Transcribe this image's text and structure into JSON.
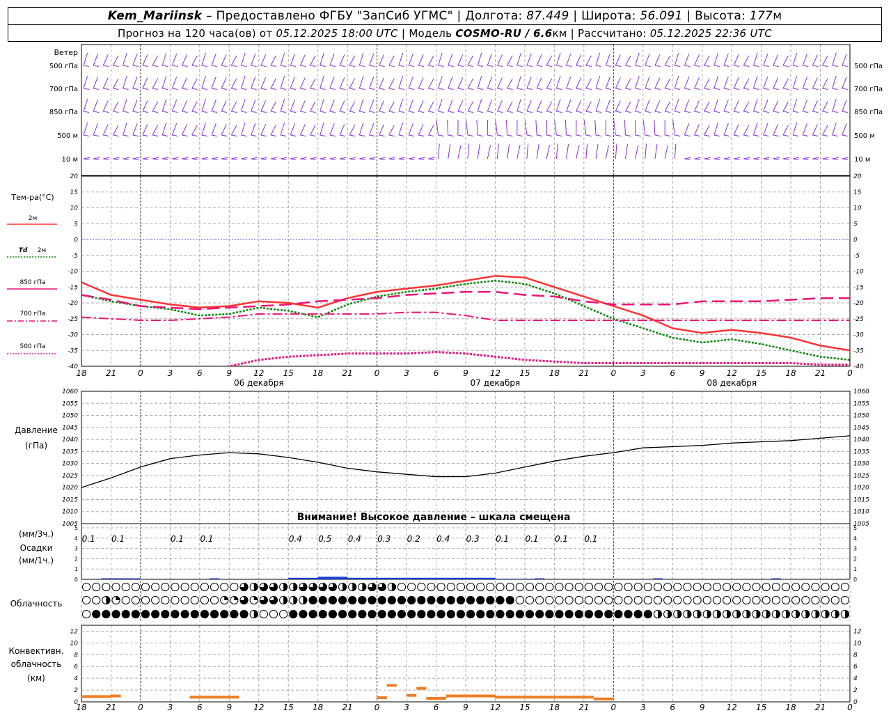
{
  "header": {
    "station": "Kem_Mariinsk",
    "dash": "–",
    "provided_by": "Предоставлено ФГБУ \"ЗапСиб УГМС\"",
    "lon_label": "Долгота:",
    "lon": "87.449",
    "lat_label": "Широта:",
    "lat": "56.091",
    "alt_label": "Высота:",
    "alt": "177",
    "alt_unit": "м",
    "sep": "|",
    "forecast_label": "Прогноз на 120 часа(ов) от",
    "forecast_from": "05.12.2025 18:00 UTC",
    "model_label": "Модель",
    "model": "COSMO-RU / 6.6",
    "model_unit": "км",
    "calc_label": "Рассчитано:",
    "calc_time": "05.12.2025 22:36 UTC"
  },
  "labels": {
    "wind_title": "Ветер",
    "wind_levels": [
      "500 гПа",
      "700 гПа",
      "850 гПа",
      "500 м",
      "10  м"
    ],
    "temp_title": "Тем-ра(°C)",
    "legend_2m": "2м",
    "legend_td": "Td",
    "legend_td_2m": "2м",
    "legend_850": "850 гПа",
    "legend_700": "700 гПа",
    "legend_500": "500 гПа",
    "pressure_title": "Давление",
    "pressure_unit": "(гПа)",
    "pressure_warning": "Внимание! Высокое давление – шкала смещена",
    "precip_unit3": "(мм/3ч.)",
    "precip_title": "Осадки",
    "precip_unit1": "(мм/1ч.)",
    "cloud_title": "Облачность",
    "conv_title1": "Конвективн.",
    "conv_title2": "облачность",
    "conv_unit": "(км)",
    "days": [
      "06 декабря",
      "07 декабря",
      "08 декабря"
    ]
  },
  "colors": {
    "t2m": "#ff3333",
    "td2m": "#008800",
    "t850": "#ee1177",
    "t700": "#ee1177",
    "t500": "#ee1177",
    "wind": "#8a2be2",
    "pressure": "#000000",
    "precip": "#1f3fd6",
    "conv": "#f07c22",
    "grid": "#aaaaaa",
    "zero_line": "#3355ff"
  },
  "chart_data": {
    "type": "meteogram",
    "hour_ticks": [
      "18",
      "21",
      "0",
      "3",
      "6",
      "9",
      "12",
      "15",
      "18",
      "21",
      "0",
      "3",
      "6",
      "9",
      "12",
      "15",
      "18",
      "21",
      "0",
      "3",
      "6",
      "9",
      "12",
      "15",
      "18",
      "21",
      "0"
    ],
    "temperature": {
      "ylim": [
        -40,
        20
      ],
      "yticks": [
        20,
        15,
        10,
        5,
        0,
        -5,
        -10,
        -15,
        -20,
        -25,
        -30,
        -35,
        -40
      ],
      "hours": [
        0,
        3,
        6,
        9,
        12,
        15,
        18,
        21,
        24,
        27,
        30,
        33,
        36,
        39,
        42,
        45,
        48,
        51,
        54,
        57,
        60,
        63,
        66,
        69,
        72,
        75,
        78
      ],
      "series": [
        {
          "name": "2м",
          "key": "t2m",
          "values": [
            -13.5,
            -17.5,
            -19,
            -20.5,
            -21.5,
            -21,
            -19.5,
            -20,
            -21.5,
            -18.5,
            -16.5,
            -15.5,
            -14.5,
            -13,
            -11.5,
            -12,
            -15,
            -18,
            -21,
            -24,
            -28,
            -29.5,
            -28.5,
            -29.5,
            -31,
            -33.5,
            -35
          ]
        },
        {
          "name": "Td 2м",
          "key": "td2m",
          "values": [
            -17.5,
            -19.5,
            -21,
            -22,
            -24,
            -23.5,
            -21.5,
            -22.5,
            -24.5,
            -20.5,
            -18,
            -16.5,
            -15.5,
            -14,
            -13,
            -14,
            -17,
            -21,
            -25,
            -28,
            -31,
            -32.5,
            -31.5,
            -33,
            -35,
            -37,
            -38
          ]
        },
        {
          "name": "850 гПа",
          "key": "t850",
          "values": [
            -17.5,
            -19,
            -21,
            -21.5,
            -22,
            -21.5,
            -21,
            -20.5,
            -19.5,
            -19,
            -18.5,
            -17.5,
            -17,
            -16.5,
            -16.5,
            -17.5,
            -18,
            -19.5,
            -20.5,
            -20.5,
            -20.5,
            -19.5,
            -19.5,
            -19.5,
            -19,
            -18.5,
            -18.5
          ]
        },
        {
          "name": "700 гПа",
          "key": "t700",
          "values": [
            -24.5,
            -25,
            -25.5,
            -25.5,
            -25,
            -24.5,
            -23.5,
            -23.5,
            -23.5,
            -23.5,
            -23.5,
            -23,
            -23,
            -24,
            -25.5,
            -25.5,
            -25.5,
            -25.5,
            -25.5,
            -25.5,
            -25.5,
            -25.5,
            -25.5,
            -25.5,
            -25.5,
            -25.5,
            -25.5
          ]
        },
        {
          "name": "500 гПа",
          "key": "t500",
          "values": [
            null,
            null,
            null,
            null,
            -41,
            -40,
            -38,
            -37,
            -36.5,
            -36,
            -36,
            -36,
            -35.5,
            -36,
            -37,
            -38,
            -38.5,
            -39,
            -39,
            -39,
            -39,
            -39,
            -39,
            -39,
            -39,
            -39.5,
            -39.5
          ]
        }
      ]
    },
    "pressure": {
      "ylim": [
        1005,
        1060
      ],
      "yticks": [
        1060,
        1055,
        1050,
        1045,
        1040,
        1035,
        1030,
        1025,
        1020,
        1015,
        1010,
        1005
      ],
      "hours": [
        0,
        3,
        6,
        9,
        12,
        15,
        18,
        21,
        24,
        27,
        30,
        33,
        36,
        39,
        42,
        45,
        48,
        51,
        54,
        57,
        60,
        63,
        66,
        69,
        72,
        75,
        78
      ],
      "values": [
        1020,
        1024,
        1028.5,
        1032,
        1033.5,
        1034.5,
        1034,
        1032.5,
        1030.5,
        1028,
        1026.5,
        1025.5,
        1024.5,
        1024.5,
        1026,
        1028.5,
        1031,
        1033,
        1034.5,
        1036.5,
        1037,
        1037.5,
        1038.5,
        1039,
        1039.5,
        1040.5,
        1041.5
      ]
    },
    "precipitation": {
      "ylim": [
        0,
        5
      ],
      "yticks": [
        5,
        4,
        3,
        2,
        1,
        0
      ],
      "labels_3h": [
        {
          "hour": 1,
          "value": "0.1"
        },
        {
          "hour": 4,
          "value": "0.1"
        },
        {
          "hour": 10,
          "value": "0.1"
        },
        {
          "hour": 13,
          "value": "0.1"
        },
        {
          "hour": 22,
          "value": "0.4"
        },
        {
          "hour": 25,
          "value": "0.5"
        },
        {
          "hour": 28,
          "value": "0.4"
        },
        {
          "hour": 31,
          "value": "0.3"
        },
        {
          "hour": 34,
          "value": "0.2"
        },
        {
          "hour": 37,
          "value": "0.4"
        },
        {
          "hour": 40,
          "value": "0.3"
        },
        {
          "hour": 43,
          "value": "0.1"
        },
        {
          "hour": 46,
          "value": "0.1"
        },
        {
          "hour": 49,
          "value": "0.1"
        },
        {
          "hour": 52,
          "value": "0.1"
        }
      ],
      "hourly": [
        {
          "start": 21,
          "end": 24,
          "value": 0.15
        },
        {
          "start": 24,
          "end": 27,
          "value": 0.25
        },
        {
          "start": 27,
          "end": 36,
          "value": 0.15
        },
        {
          "start": 36,
          "end": 42,
          "value": 0.15
        },
        {
          "start": 42,
          "end": 46,
          "value": 0.06
        }
      ]
    },
    "clouds": {
      "hours_step": 1,
      "rows": [
        {
          "name": "upper",
          "segments": [
            [
              0,
              16,
              0
            ],
            [
              16,
              17,
              0.75
            ],
            [
              17,
              18,
              0.5
            ],
            [
              18,
              20,
              0.75
            ],
            [
              20,
              22,
              0.5
            ],
            [
              22,
              26,
              0.75
            ],
            [
              26,
              29,
              0.5
            ],
            [
              29,
              31,
              0.75
            ],
            [
              31,
              32,
              0.5
            ],
            [
              32,
              78,
              0
            ]
          ]
        },
        {
          "name": "middle",
          "segments": [
            [
              0,
              2,
              0
            ],
            [
              2,
              3,
              0.5
            ],
            [
              3,
              4,
              0.25
            ],
            [
              4,
              14,
              0
            ],
            [
              14,
              15,
              0.25
            ],
            [
              15,
              16,
              0.25
            ],
            [
              16,
              17,
              0.75
            ],
            [
              17,
              18,
              0.25
            ],
            [
              18,
              20,
              0.75
            ],
            [
              20,
              23,
              0.5
            ],
            [
              23,
              44,
              1
            ],
            [
              44,
              78,
              0
            ]
          ]
        },
        {
          "name": "lower",
          "segments": [
            [
              0,
              1,
              0
            ],
            [
              1,
              17,
              1
            ],
            [
              17,
              18,
              0.5
            ],
            [
              18,
              21,
              0
            ],
            [
              21,
              58,
              1
            ],
            [
              58,
              59,
              0.5
            ],
            [
              59,
              60,
              0.5
            ],
            [
              60,
              66,
              0.5
            ],
            [
              66,
              78,
              0.5
            ]
          ]
        }
      ]
    },
    "convective": {
      "ylim": [
        0,
        13
      ],
      "yticks": [
        12,
        10,
        8,
        6,
        4,
        2,
        0
      ],
      "segments": [
        {
          "start": 0,
          "end": 3,
          "value": 0.9
        },
        {
          "start": 3,
          "end": 4,
          "value": 1.0
        },
        {
          "start": 11,
          "end": 16,
          "value": 0.8
        },
        {
          "start": 30,
          "end": 31,
          "value": 0.7
        },
        {
          "start": 31,
          "end": 32,
          "value": 2.8
        },
        {
          "start": 33,
          "end": 34,
          "value": 1.1
        },
        {
          "start": 34,
          "end": 35,
          "value": 2.3
        },
        {
          "start": 35,
          "end": 37,
          "value": 0.6
        },
        {
          "start": 37,
          "end": 42,
          "value": 1.0
        },
        {
          "start": 42,
          "end": 52,
          "value": 0.8
        },
        {
          "start": 52,
          "end": 54,
          "value": 0.5
        }
      ]
    },
    "wind": {
      "level_names": [
        "500 гПа",
        "700 гПа",
        "850 гПа",
        "500 м",
        "10  м"
      ]
    }
  }
}
